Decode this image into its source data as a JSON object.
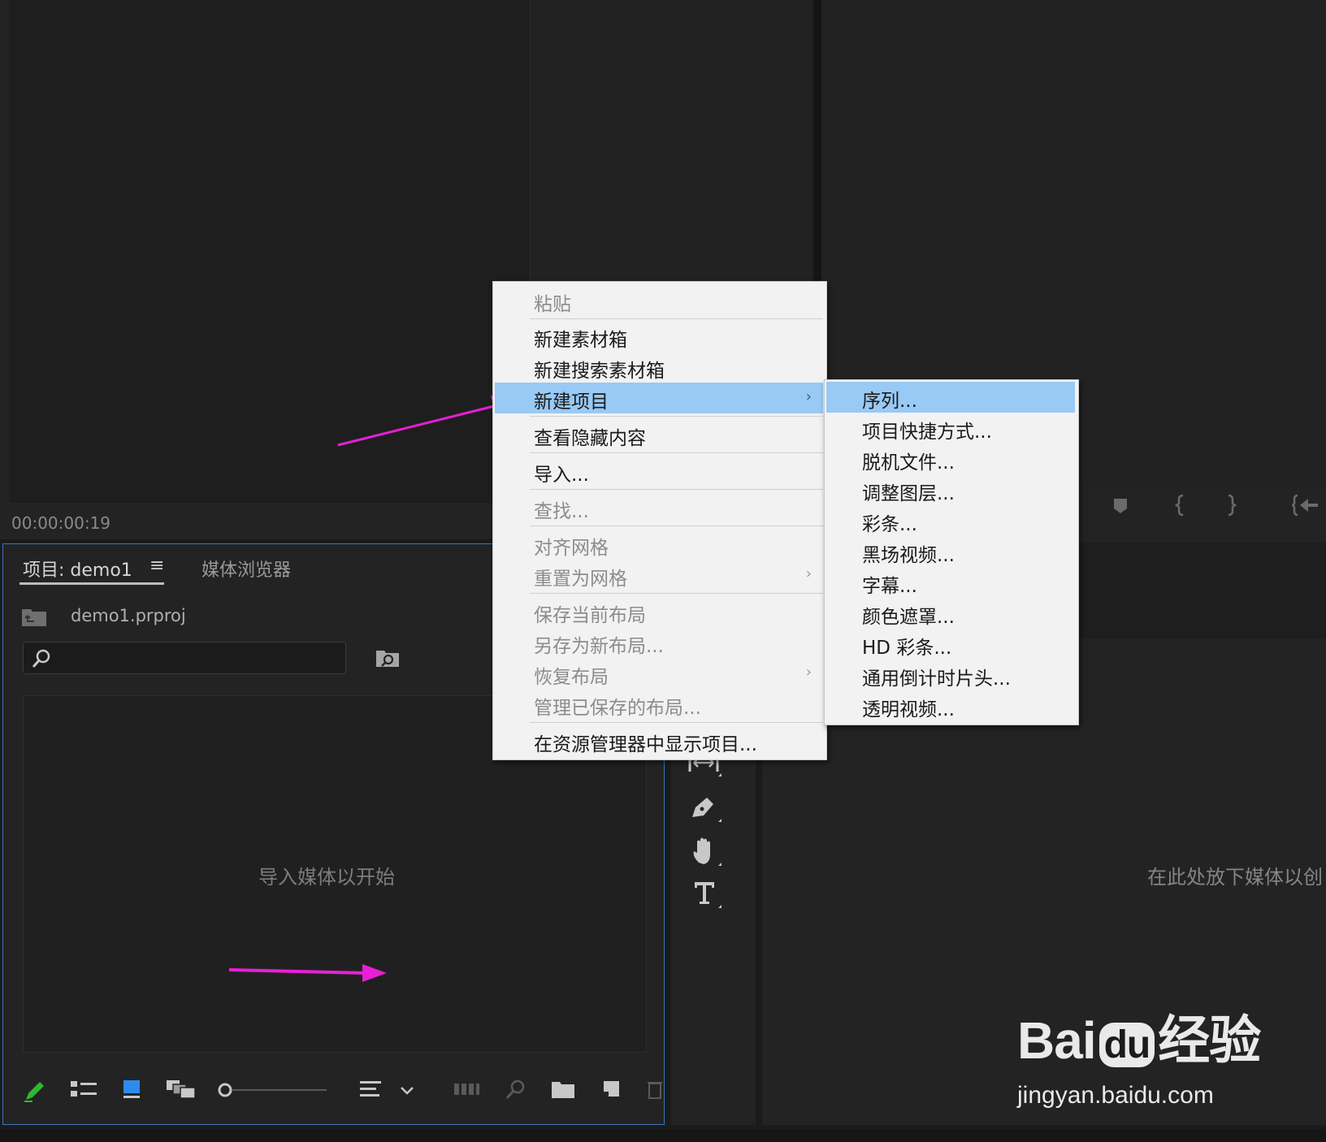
{
  "source_monitor": {
    "timecode": "00:00:00:19"
  },
  "project_panel": {
    "tab_project": "项目: demo1",
    "tab_menu_icon": "hamburger-icon",
    "tab_media_browser": "媒体浏览器",
    "file_name": "demo1.prproj",
    "empty_hint": "导入媒体以开始"
  },
  "timeline": {
    "drop_hint": "在此处放下媒体以创"
  },
  "context_menu": {
    "items": {
      "paste": "粘贴",
      "new_bin": "新建素材箱",
      "new_search_bin": "新建搜索素材箱",
      "new_item": "新建项目",
      "view_hidden": "查看隐藏内容",
      "import": "导入...",
      "find": "查找...",
      "align_grid": "对齐网格",
      "reset_grid": "重置为网格",
      "save_layout": "保存当前布局",
      "save_as_layout": "另存为新布局...",
      "restore_layout": "恢复布局",
      "manage_layouts": "管理已保存的布局...",
      "reveal_explorer": "在资源管理器中显示项目..."
    },
    "submenu_arrow": "›"
  },
  "submenu": {
    "items": [
      "序列...",
      "项目快捷方式...",
      "脱机文件...",
      "调整图层...",
      "彩条...",
      "黑场视频...",
      "字幕...",
      "颜色遮罩...",
      "HD 彩条...",
      "通用倒计时片头...",
      "透明视频..."
    ]
  },
  "watermark": {
    "logo": "Bai du 经验",
    "site": "jingyan.baidu.com"
  },
  "colors": {
    "menu_highlight": "#99c9f5",
    "annotation_arrow": "#e81fd6",
    "panel_focus_border": "#3d74b8"
  }
}
